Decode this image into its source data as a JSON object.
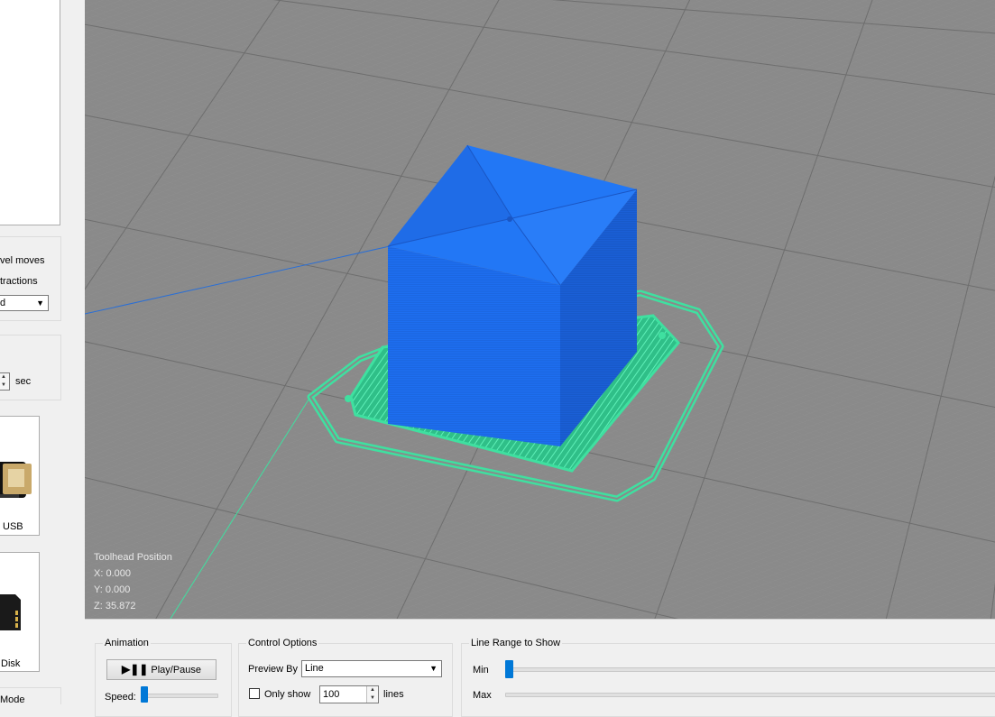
{
  "left_panel": {
    "travel_moves_label": "vel moves",
    "retractions_label": "tractions",
    "color_select_value": "d",
    "seconds_unit": "sec",
    "device_usb_label": "USB",
    "device_disk_label": "Disk",
    "mode_label": "Mode"
  },
  "viewport": {
    "toolhead": {
      "title": "Toolhead Position",
      "x": "X: 0.000",
      "y": "Y: 0.000",
      "z": "Z: 35.872"
    },
    "colors": {
      "background": "#8a8a8a",
      "model": "#1f6fe8",
      "skirt": "#3fe0a0",
      "travel_line": "#2a6fd6"
    }
  },
  "animation": {
    "title": "Animation",
    "play_pause_label": "Play/Pause",
    "play_pause_icon": "play-pause-icon",
    "speed_label": "Speed:"
  },
  "control_options": {
    "title": "Control Options",
    "preview_by_label": "Preview By",
    "preview_by_value": "Line",
    "only_show_label": "Only show",
    "only_show_checked": false,
    "only_show_value": "100",
    "lines_unit": "lines"
  },
  "line_range": {
    "title": "Line Range to Show",
    "min_label": "Min",
    "max_label": "Max",
    "min_value": 0
  }
}
